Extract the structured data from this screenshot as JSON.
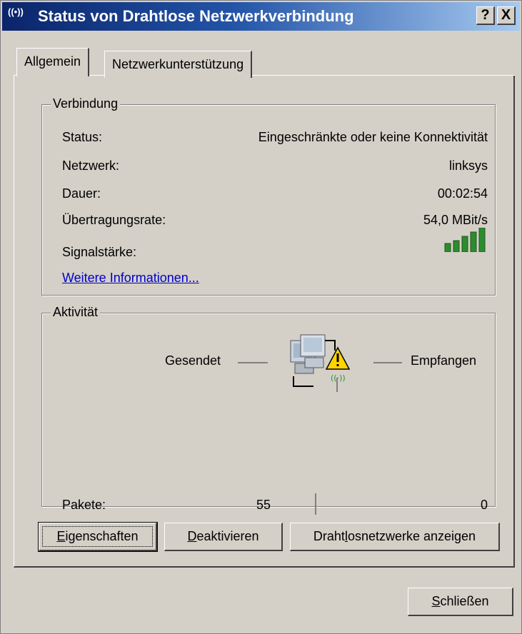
{
  "window": {
    "title": "Status von Drahtlose Netzwerkverbindung",
    "help_button": "?",
    "close_button": "X",
    "title_icon_glyph": "((•))"
  },
  "tabs": [
    {
      "label": "Allgemein",
      "active": true
    },
    {
      "label": "Netzwerkunterstützung",
      "active": false
    }
  ],
  "verbindung": {
    "group_label": "Verbindung",
    "rows": [
      {
        "label": "Status:",
        "value": "Eingeschränkte oder keine Konnektivität"
      },
      {
        "label": "Netzwerk:",
        "value": "linksys"
      },
      {
        "label": "Dauer:",
        "value": "00:02:54"
      },
      {
        "label": "Übertragungsrate:",
        "value": "54,0 MBit/s"
      },
      {
        "label": "Signalstärke:",
        "value": ""
      }
    ],
    "signal_level_bars": 5,
    "signal_max_bars": 5,
    "more_info_link": "Weitere Informationen..."
  },
  "aktivitaet": {
    "group_label": "Aktivität",
    "sent_label": "Gesendet",
    "received_label": "Empfangen",
    "packets_label": "Pakete:",
    "packets_sent": "55",
    "packets_received": "0",
    "status_icon": "network-warning-icon"
  },
  "buttons": {
    "properties": {
      "accel": "E",
      "rest": "igenschaften"
    },
    "deactivate": {
      "accel": "D",
      "rest": "eaktivieren"
    },
    "show_networks": {
      "pre": "Draht",
      "accel": "l",
      "rest": "osnetzwerke anzeigen"
    },
    "close": {
      "accel": "S",
      "rest": "chließen"
    }
  },
  "colors": {
    "title_start": "#0a246a",
    "title_end": "#a6caf0",
    "face": "#d4d0c8",
    "link": "#0000cc",
    "signal": "#2e8b2e"
  }
}
